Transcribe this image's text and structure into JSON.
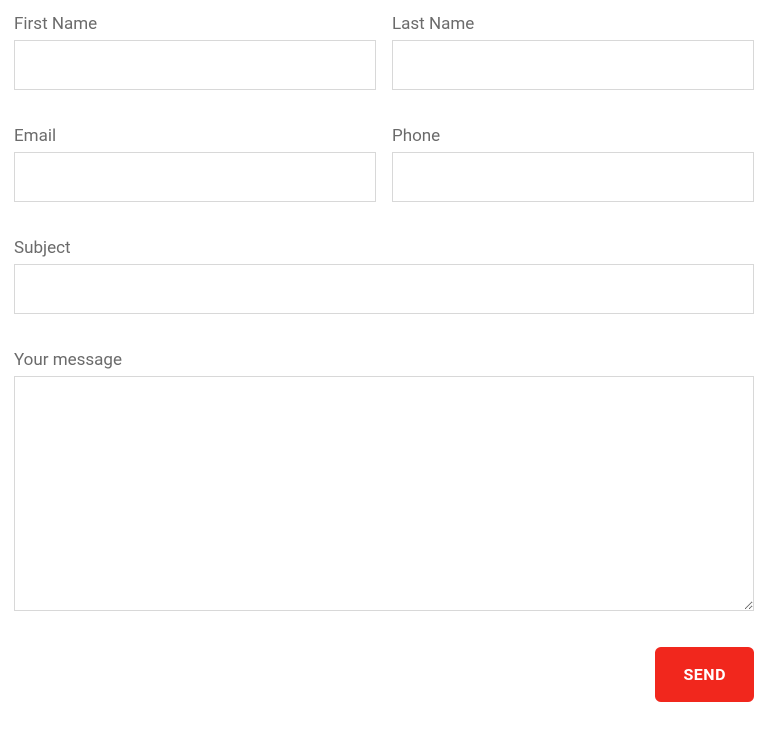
{
  "form": {
    "firstName": {
      "label": "First Name",
      "value": ""
    },
    "lastName": {
      "label": "Last Name",
      "value": ""
    },
    "email": {
      "label": "Email",
      "value": ""
    },
    "phone": {
      "label": "Phone",
      "value": ""
    },
    "subject": {
      "label": "Subject",
      "value": ""
    },
    "message": {
      "label": "Your message",
      "value": ""
    },
    "submit": {
      "label": "SEND"
    }
  }
}
